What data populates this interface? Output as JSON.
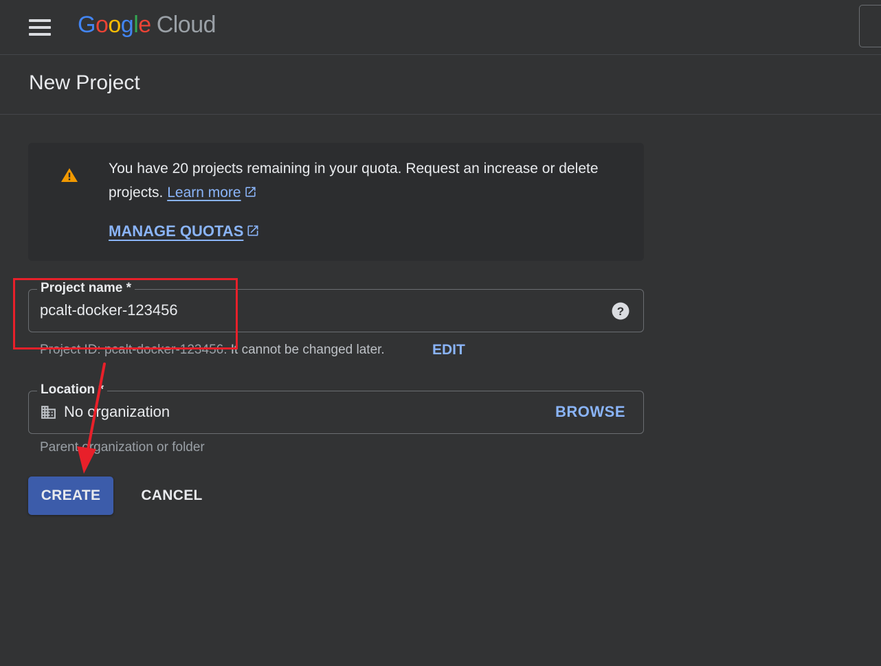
{
  "app": {
    "logo_google": "Google",
    "logo_cloud": "Cloud"
  },
  "header": {
    "title": "New Project"
  },
  "notice": {
    "text": "You have 20 projects remaining in your quota. Request an increase or delete projects.",
    "learn_more": "Learn more",
    "manage_quotas": "MANAGE QUOTAS"
  },
  "project_name": {
    "label": "Project name *",
    "value": "pcalt-docker-123456"
  },
  "project_id": {
    "prefix": "Project ID:",
    "value": "pcalt-docker-123456.",
    "suffix": "It cannot be changed later.",
    "edit_label": "EDIT"
  },
  "location": {
    "label": "Location *",
    "value": "No organization",
    "browse_label": "BROWSE",
    "hint": "Parent organization or folder"
  },
  "actions": {
    "create_label": "CREATE",
    "cancel_label": "CANCEL"
  },
  "colors": {
    "background": "#323334",
    "link": "#8ab4f8",
    "primary_button": "#3c5caa",
    "warning": "#f29900",
    "annotation": "#e8202a"
  }
}
